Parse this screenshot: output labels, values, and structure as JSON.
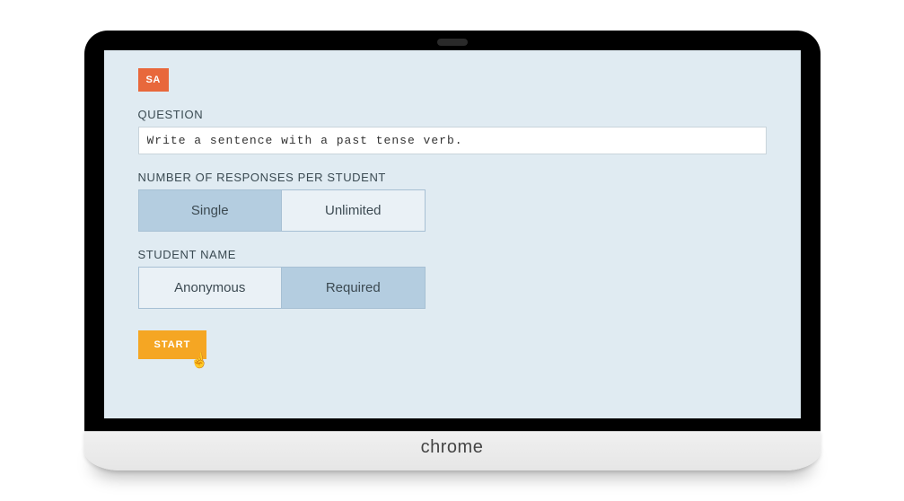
{
  "badge": "SA",
  "question": {
    "label": "QUESTION",
    "value": "Write a sentence with a past tense verb."
  },
  "responses": {
    "label": "NUMBER OF RESPONSES PER STUDENT",
    "options": [
      "Single",
      "Unlimited"
    ],
    "selected": "Single"
  },
  "student_name": {
    "label": "STUDENT NAME",
    "options": [
      "Anonymous",
      "Required"
    ],
    "selected": "Required"
  },
  "start_label": "START",
  "branding": "chrome"
}
